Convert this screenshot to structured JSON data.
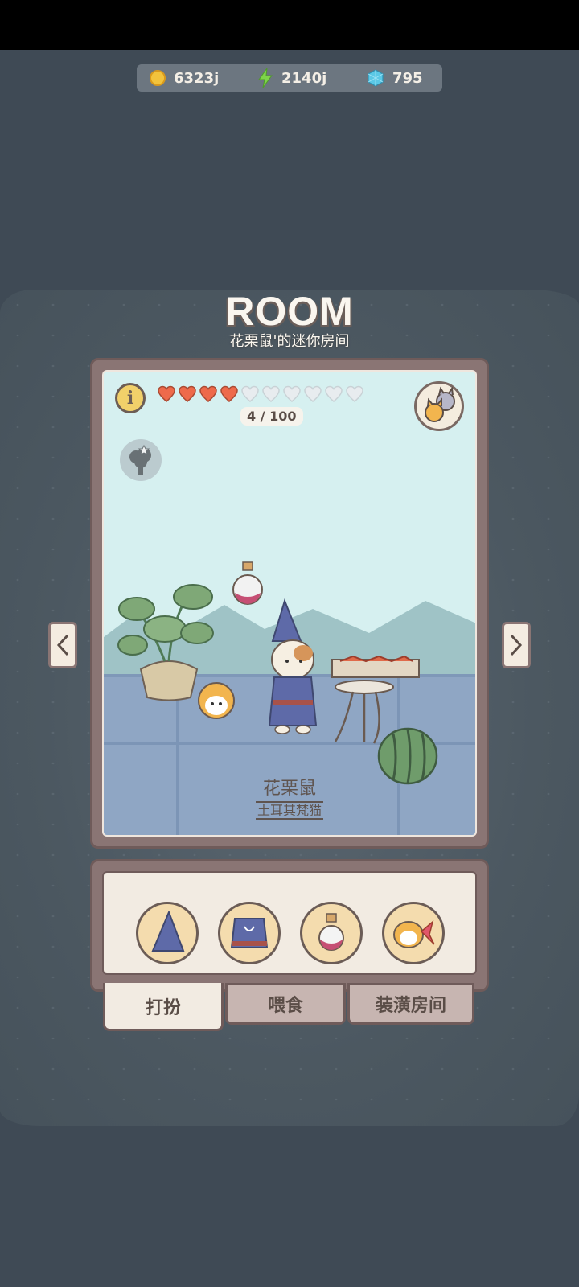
{
  "resources": {
    "coins": "6323j",
    "energy": "2140j",
    "gems": "795"
  },
  "header": {
    "title": "ROOM",
    "subtitle": "花栗鼠'的迷你房间"
  },
  "room": {
    "info_symbol": "i",
    "hearts_filled": 4,
    "hearts_total": 10,
    "hp_text": "4 / 100",
    "pet_name": "花栗鼠",
    "pet_breed": "土耳其梵猫"
  },
  "tabs": [
    {
      "label": "打扮",
      "active": true
    },
    {
      "label": "喂食",
      "active": false
    },
    {
      "label": "装潢房间",
      "active": false
    }
  ],
  "items": [
    "wizard-hat-icon",
    "wizard-robe-icon",
    "potion-icon",
    "fish-fish-icon"
  ],
  "colors": {
    "heart_filled": "#ee6a4b",
    "heart_empty": "#e8ecef",
    "coin": "#f2c33c",
    "energy": "#7ed44a",
    "gem": "#5bc8e6"
  }
}
